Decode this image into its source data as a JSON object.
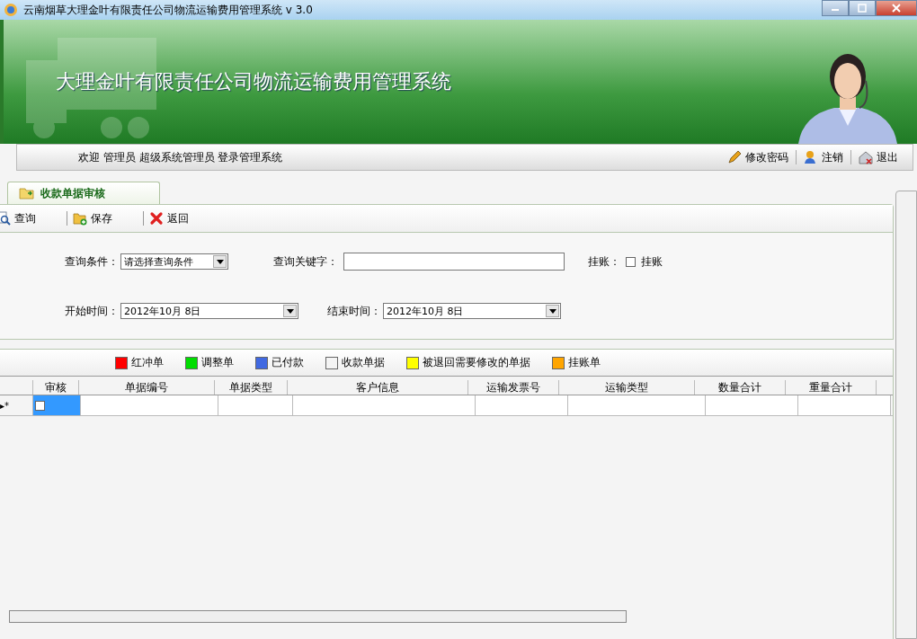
{
  "window": {
    "title": "云南烟草大理金叶有限责任公司物流运输费用管理系统 v 3.0"
  },
  "banner": {
    "title": "大理金叶有限责任公司物流运输费用管理系统"
  },
  "user_bar": {
    "welcome": "欢迎 管理员 超级系统管理员 登录管理系统",
    "actions": [
      {
        "kind": "password",
        "label": "修改密码"
      },
      {
        "kind": "logout",
        "label": "注销"
      },
      {
        "kind": "exit",
        "label": "退出"
      }
    ]
  },
  "tabs": [
    {
      "label": "收款单据审核",
      "selected": true
    }
  ],
  "toolbar": [
    {
      "kind": "search",
      "label": "查询"
    },
    {
      "kind": "save",
      "label": "保存"
    },
    {
      "kind": "back",
      "label": "返回"
    }
  ],
  "filters": {
    "condition_label": "查询条件：",
    "condition_value": "请选择查询条件",
    "keyword_label": "查询关键字：",
    "onhold_label": "挂账：",
    "onhold": {
      "label": "挂账",
      "checked": false
    },
    "start_label": "开始时间：",
    "start_value": "2012年10月  8日",
    "end_label": "结束时间：",
    "end_value": "2012年10月  8日"
  },
  "legend": [
    {
      "label": "红冲单",
      "color": "#ff0000"
    },
    {
      "label": "调整单",
      "color": "#00dd00"
    },
    {
      "label": "已付款",
      "color": "#4169e1"
    },
    {
      "label": "收款单据",
      "color": "#f4f4f4"
    },
    {
      "label": "被退回需要修改的单据",
      "color": "#ffff00"
    },
    {
      "label": "挂账单",
      "color": "#ffa500"
    }
  ],
  "table": {
    "columns": [
      "审核",
      "单据编号",
      "单据类型",
      "客户信息",
      "运输发票号",
      "运输类型",
      "数量合计",
      "重量合计"
    ],
    "rows": [
      {
        "marker": "▸*",
        "checked": false,
        "selected": true
      }
    ]
  }
}
